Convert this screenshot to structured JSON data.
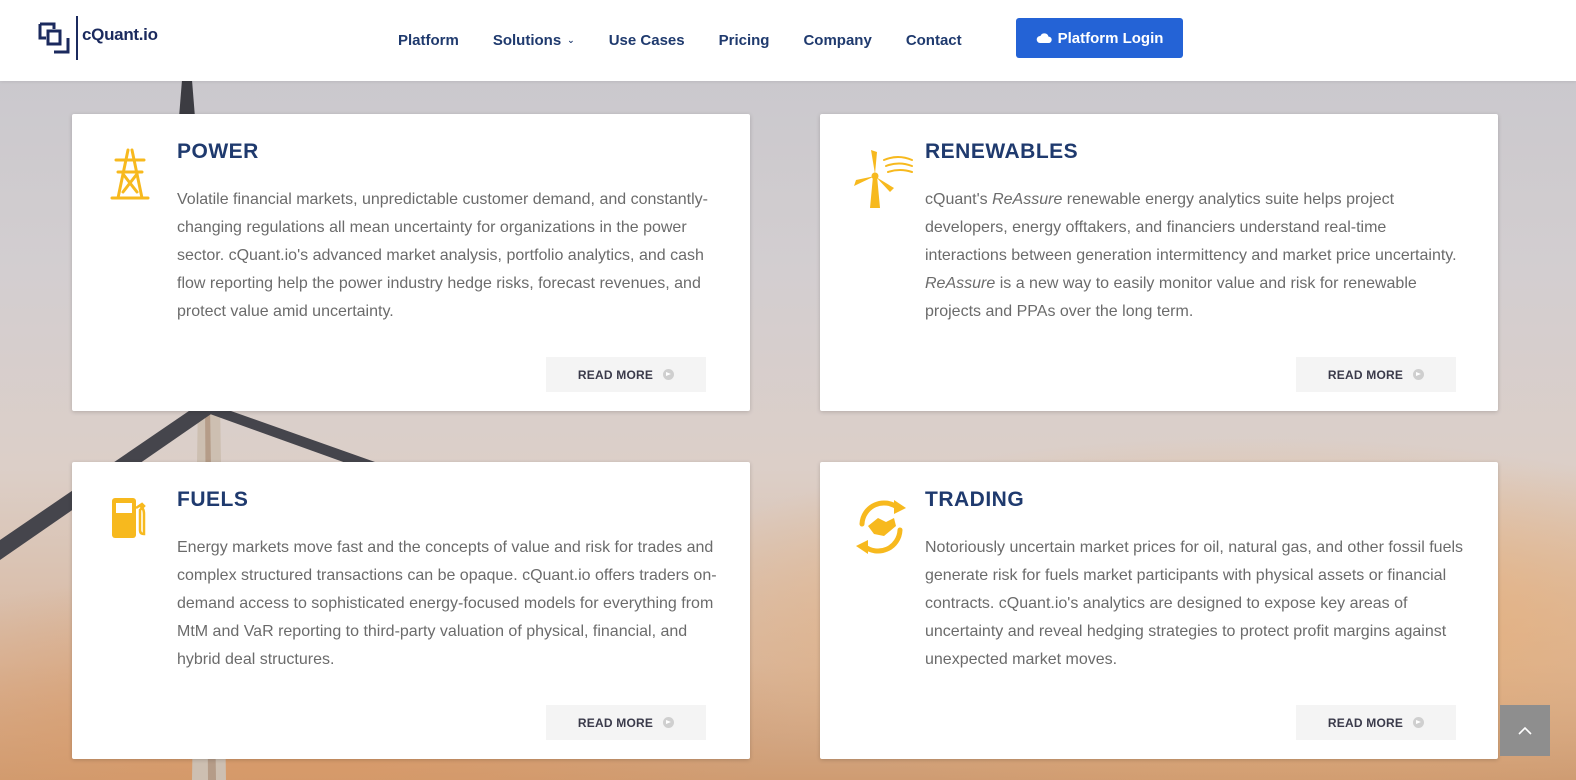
{
  "brand": {
    "name": "cQuant.io",
    "colors": {
      "navy": "#1f3a6e",
      "accent_blue": "#2463d6",
      "icon_yellow": "#f7b91e",
      "body_text": "#6b6b6b"
    }
  },
  "nav": {
    "items": [
      {
        "label": "Platform"
      },
      {
        "label": "Solutions",
        "has_dropdown": true
      },
      {
        "label": "Use Cases"
      },
      {
        "label": "Pricing"
      },
      {
        "label": "Company"
      },
      {
        "label": "Contact"
      }
    ],
    "login": {
      "label": "Platform Login",
      "icon": "cloud-icon"
    }
  },
  "cards": [
    {
      "icon": "power-tower-icon",
      "title": "POWER",
      "text": "Volatile financial markets, unpredictable customer demand, and constantly-changing regulations all mean uncertainty for organizations in the power sector. cQuant.io's advanced market analysis, portfolio analytics, and cash flow reporting help the power industry hedge risks, forecast revenues, and protect value amid uncertainty.",
      "button": "READ MORE"
    },
    {
      "icon": "wind-turbine-icon",
      "title": "RENEWABLES",
      "text_parts": [
        "cQuant's ",
        "ReAssure",
        " renewable energy analytics suite helps project developers, energy offtakers, and financiers understand real-time interactions between generation intermittency and market price uncertainty. ",
        "ReAssure",
        " is a new way to easily monitor value and risk for renewable projects and PPAs over the long term."
      ],
      "button": "READ MORE"
    },
    {
      "icon": "fuel-pump-icon",
      "title": "FUELS",
      "text": "Energy markets move fast and the concepts of value and risk for trades and complex structured transactions can be opaque. cQuant.io offers traders on-demand access to sophisticated energy-focused models for everything from MtM and VaR reporting to third-party valuation of physical, financial, and hybrid deal structures.",
      "button": "READ MORE"
    },
    {
      "icon": "handshake-icon",
      "title": "TRADING",
      "text": "Notoriously uncertain market prices for oil, natural gas, and other fossil fuels generate risk for fuels market participants with physical assets or financial contracts. cQuant.io's analytics are designed to expose key areas of uncertainty and reveal hedging strategies to protect profit margins against unexpected market moves.",
      "button": "READ MORE"
    }
  ],
  "scroll_top": {
    "icon": "chevron-up-icon"
  }
}
